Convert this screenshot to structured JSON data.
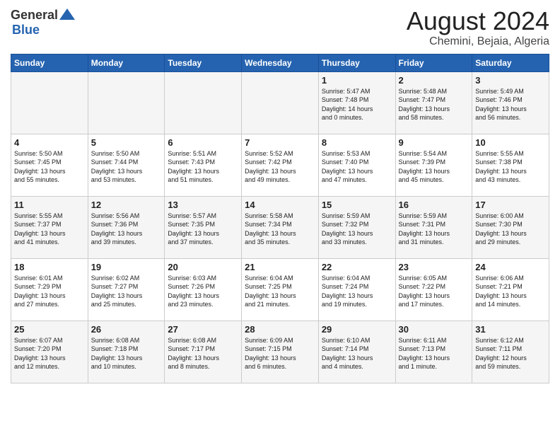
{
  "header": {
    "logo_general": "General",
    "logo_blue": "Blue",
    "month_year": "August 2024",
    "location": "Chemini, Bejaia, Algeria"
  },
  "weekdays": [
    "Sunday",
    "Monday",
    "Tuesday",
    "Wednesday",
    "Thursday",
    "Friday",
    "Saturday"
  ],
  "rows": [
    [
      {
        "day": "",
        "info": ""
      },
      {
        "day": "",
        "info": ""
      },
      {
        "day": "",
        "info": ""
      },
      {
        "day": "",
        "info": ""
      },
      {
        "day": "1",
        "info": "Sunrise: 5:47 AM\nSunset: 7:48 PM\nDaylight: 14 hours\nand 0 minutes."
      },
      {
        "day": "2",
        "info": "Sunrise: 5:48 AM\nSunset: 7:47 PM\nDaylight: 13 hours\nand 58 minutes."
      },
      {
        "day": "3",
        "info": "Sunrise: 5:49 AM\nSunset: 7:46 PM\nDaylight: 13 hours\nand 56 minutes."
      }
    ],
    [
      {
        "day": "4",
        "info": "Sunrise: 5:50 AM\nSunset: 7:45 PM\nDaylight: 13 hours\nand 55 minutes."
      },
      {
        "day": "5",
        "info": "Sunrise: 5:50 AM\nSunset: 7:44 PM\nDaylight: 13 hours\nand 53 minutes."
      },
      {
        "day": "6",
        "info": "Sunrise: 5:51 AM\nSunset: 7:43 PM\nDaylight: 13 hours\nand 51 minutes."
      },
      {
        "day": "7",
        "info": "Sunrise: 5:52 AM\nSunset: 7:42 PM\nDaylight: 13 hours\nand 49 minutes."
      },
      {
        "day": "8",
        "info": "Sunrise: 5:53 AM\nSunset: 7:40 PM\nDaylight: 13 hours\nand 47 minutes."
      },
      {
        "day": "9",
        "info": "Sunrise: 5:54 AM\nSunset: 7:39 PM\nDaylight: 13 hours\nand 45 minutes."
      },
      {
        "day": "10",
        "info": "Sunrise: 5:55 AM\nSunset: 7:38 PM\nDaylight: 13 hours\nand 43 minutes."
      }
    ],
    [
      {
        "day": "11",
        "info": "Sunrise: 5:55 AM\nSunset: 7:37 PM\nDaylight: 13 hours\nand 41 minutes."
      },
      {
        "day": "12",
        "info": "Sunrise: 5:56 AM\nSunset: 7:36 PM\nDaylight: 13 hours\nand 39 minutes."
      },
      {
        "day": "13",
        "info": "Sunrise: 5:57 AM\nSunset: 7:35 PM\nDaylight: 13 hours\nand 37 minutes."
      },
      {
        "day": "14",
        "info": "Sunrise: 5:58 AM\nSunset: 7:34 PM\nDaylight: 13 hours\nand 35 minutes."
      },
      {
        "day": "15",
        "info": "Sunrise: 5:59 AM\nSunset: 7:32 PM\nDaylight: 13 hours\nand 33 minutes."
      },
      {
        "day": "16",
        "info": "Sunrise: 5:59 AM\nSunset: 7:31 PM\nDaylight: 13 hours\nand 31 minutes."
      },
      {
        "day": "17",
        "info": "Sunrise: 6:00 AM\nSunset: 7:30 PM\nDaylight: 13 hours\nand 29 minutes."
      }
    ],
    [
      {
        "day": "18",
        "info": "Sunrise: 6:01 AM\nSunset: 7:29 PM\nDaylight: 13 hours\nand 27 minutes."
      },
      {
        "day": "19",
        "info": "Sunrise: 6:02 AM\nSunset: 7:27 PM\nDaylight: 13 hours\nand 25 minutes."
      },
      {
        "day": "20",
        "info": "Sunrise: 6:03 AM\nSunset: 7:26 PM\nDaylight: 13 hours\nand 23 minutes."
      },
      {
        "day": "21",
        "info": "Sunrise: 6:04 AM\nSunset: 7:25 PM\nDaylight: 13 hours\nand 21 minutes."
      },
      {
        "day": "22",
        "info": "Sunrise: 6:04 AM\nSunset: 7:24 PM\nDaylight: 13 hours\nand 19 minutes."
      },
      {
        "day": "23",
        "info": "Sunrise: 6:05 AM\nSunset: 7:22 PM\nDaylight: 13 hours\nand 17 minutes."
      },
      {
        "day": "24",
        "info": "Sunrise: 6:06 AM\nSunset: 7:21 PM\nDaylight: 13 hours\nand 14 minutes."
      }
    ],
    [
      {
        "day": "25",
        "info": "Sunrise: 6:07 AM\nSunset: 7:20 PM\nDaylight: 13 hours\nand 12 minutes."
      },
      {
        "day": "26",
        "info": "Sunrise: 6:08 AM\nSunset: 7:18 PM\nDaylight: 13 hours\nand 10 minutes."
      },
      {
        "day": "27",
        "info": "Sunrise: 6:08 AM\nSunset: 7:17 PM\nDaylight: 13 hours\nand 8 minutes."
      },
      {
        "day": "28",
        "info": "Sunrise: 6:09 AM\nSunset: 7:15 PM\nDaylight: 13 hours\nand 6 minutes."
      },
      {
        "day": "29",
        "info": "Sunrise: 6:10 AM\nSunset: 7:14 PM\nDaylight: 13 hours\nand 4 minutes."
      },
      {
        "day": "30",
        "info": "Sunrise: 6:11 AM\nSunset: 7:13 PM\nDaylight: 13 hours\nand 1 minute."
      },
      {
        "day": "31",
        "info": "Sunrise: 6:12 AM\nSunset: 7:11 PM\nDaylight: 12 hours\nand 59 minutes."
      }
    ]
  ]
}
